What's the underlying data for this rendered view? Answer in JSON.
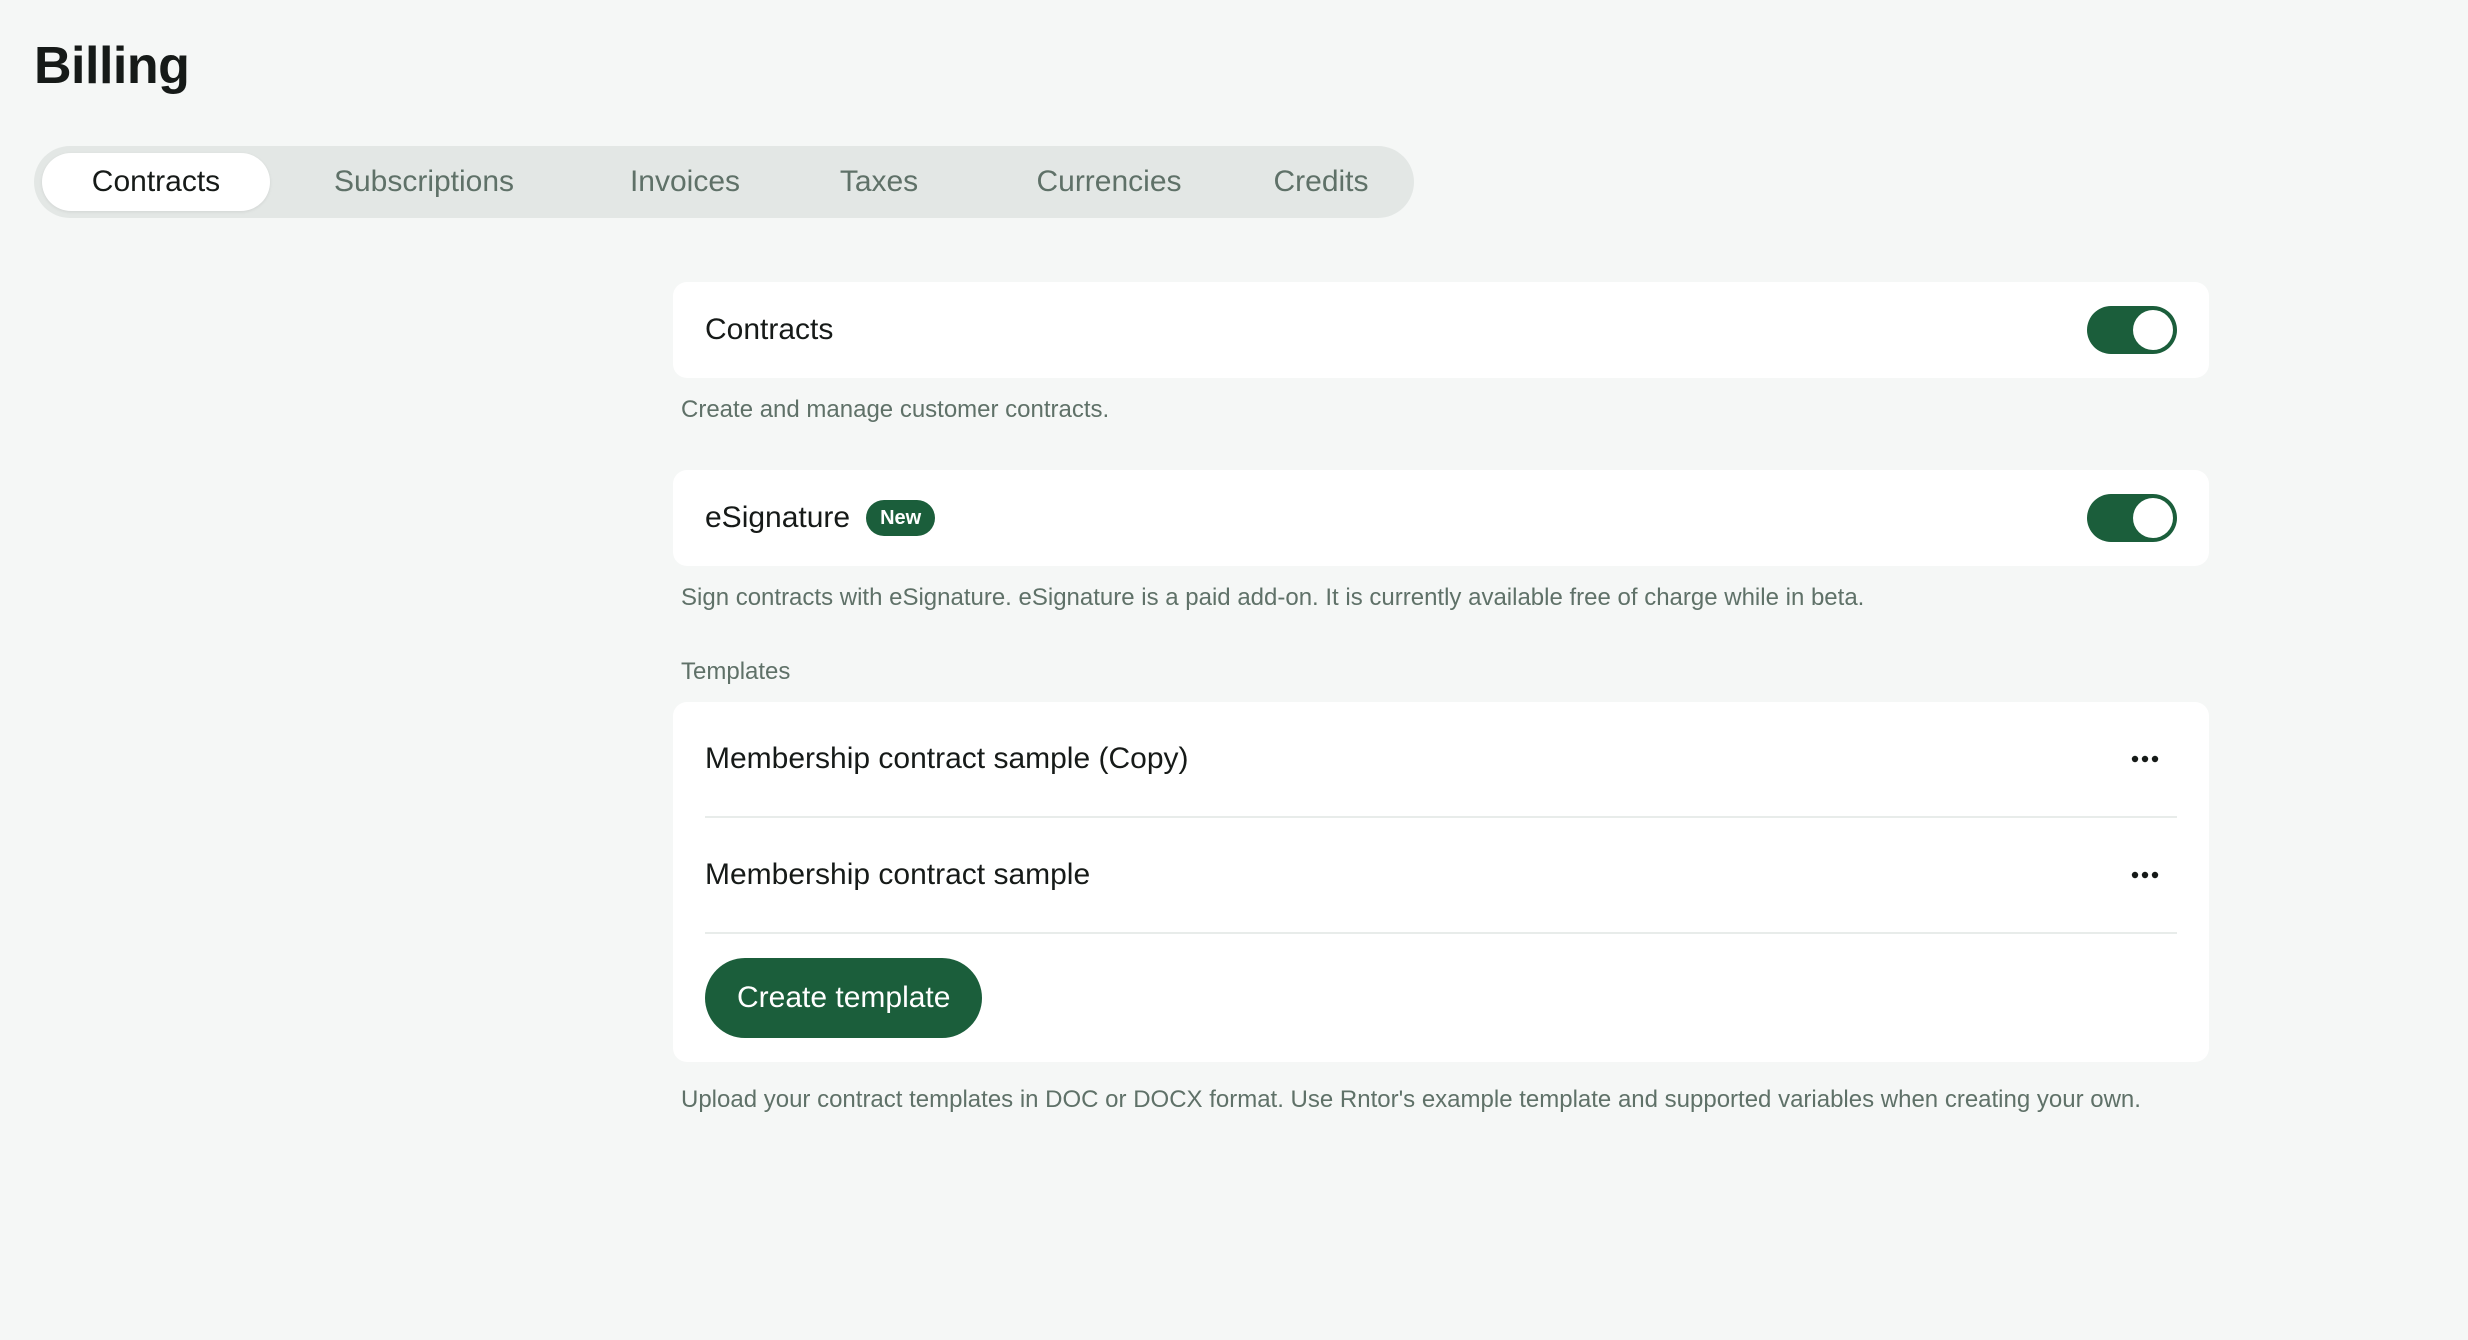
{
  "page": {
    "title": "Billing"
  },
  "tabs": [
    {
      "label": "Contracts",
      "active": true
    },
    {
      "label": "Subscriptions",
      "active": false
    },
    {
      "label": "Invoices",
      "active": false
    },
    {
      "label": "Taxes",
      "active": false
    },
    {
      "label": "Currencies",
      "active": false
    },
    {
      "label": "Credits",
      "active": false
    }
  ],
  "contracts": {
    "label": "Contracts",
    "enabled": true,
    "description": "Create and manage customer contracts."
  },
  "esignature": {
    "label": "eSignature",
    "badge": "New",
    "enabled": true,
    "description": "Sign contracts with eSignature. eSignature is a paid add-on. It is currently available free of charge while in beta."
  },
  "templates": {
    "section_label": "Templates",
    "items": [
      {
        "name": "Membership contract sample (Copy)",
        "menu_icon": "more-horizontal-icon"
      },
      {
        "name": "Membership contract sample",
        "menu_icon": "more-horizontal-icon"
      }
    ],
    "create_button_label": "Create template",
    "description": "Upload your contract templates in DOC or DOCX format. Use Rntor's example template and supported variables when creating your own."
  },
  "colors": {
    "accent": "#1b5e3b",
    "background": "#f5f7f6",
    "tab_track": "#e3e7e5",
    "muted_text": "#5f7168"
  }
}
